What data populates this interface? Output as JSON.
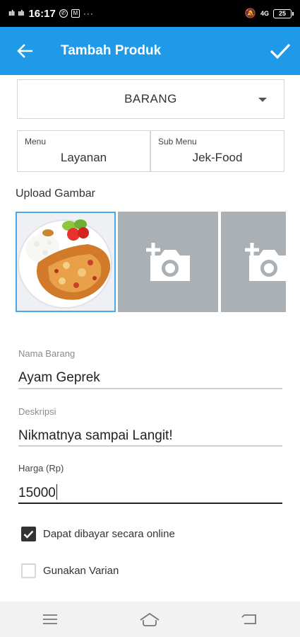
{
  "status_bar": {
    "signal1": "ıılı",
    "signal2": "ıılı",
    "time": "16:17",
    "network": "4G",
    "battery": "25"
  },
  "app_bar": {
    "title": "Tambah Produk"
  },
  "type_select": {
    "value": "BARANG"
  },
  "menu": {
    "label": "Menu",
    "value": "Layanan"
  },
  "sub_menu": {
    "label": "Sub Menu",
    "value": "Jek-Food"
  },
  "upload": {
    "label": "Upload Gambar"
  },
  "form": {
    "name_label": "Nama Barang",
    "name_value": "Ayam Geprek",
    "desc_label": "Deskripsi",
    "desc_value": "Nikmatnya sampai Langit!",
    "price_label": "Harga (Rp)",
    "price_value": "15000"
  },
  "options": {
    "online_payment": {
      "label": "Dapat dibayar secara online",
      "checked": true
    },
    "variant": {
      "label": "Gunakan Varian",
      "checked": false
    }
  },
  "colors": {
    "primary": "#1e9ae8",
    "upload_slot": "#aab0b4"
  }
}
